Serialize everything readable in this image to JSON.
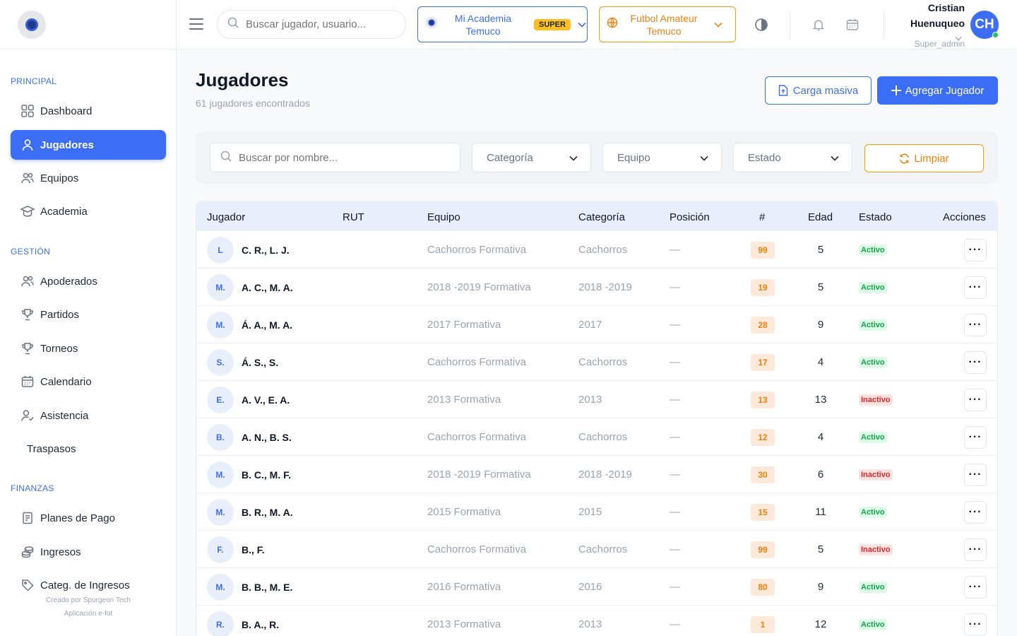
{
  "sidebar": {
    "sections": {
      "principal": "PRINCIPAL",
      "gestion": "GESTIÓN",
      "finanzas": "FINANZAS"
    },
    "items": {
      "dashboard": "Dashboard",
      "jugadores": "Jugadores",
      "equipos": "Equipos",
      "academia": "Academia",
      "apoderados": "Apoderados",
      "partidos": "Partidos",
      "torneos": "Torneos",
      "calendario": "Calendario",
      "asistencia": "Asistencia",
      "traspasos": "Traspasos",
      "planes": "Planes de Pago",
      "ingresos": "Ingresos",
      "categ": "Categ. de Ingresos"
    },
    "footer": {
      "created_by": "Creado por Spurgeon Tech",
      "app": "Aplicación e-fot"
    }
  },
  "header": {
    "search_placeholder": "Buscar jugador, usuario...",
    "academy": {
      "line1": "Mi Academia",
      "line2": "Temuco",
      "badge": "SUPER"
    },
    "league": {
      "line1": "Futbol Amateur",
      "line2": "Temuco"
    },
    "user": {
      "first": "Cristian",
      "last": "Huenuqueo",
      "role": "Super_admin",
      "initials": "CH"
    }
  },
  "page": {
    "title": "Jugadores",
    "subtitle": "61 jugadores encontrados",
    "btn_carga": "Carga masiva",
    "btn_agregar": "Agregar Jugador"
  },
  "filters": {
    "search_placeholder": "Buscar por nombre...",
    "categoria": "Categoría",
    "equipo": "Equipo",
    "estado": "Estado",
    "limpiar": "Limpiar"
  },
  "table": {
    "headers": {
      "jugador": "Jugador",
      "rut": "RUT",
      "equipo": "Equipo",
      "categoria": "Categoría",
      "posicion": "Posición",
      "numero": "#",
      "edad": "Edad",
      "estado": "Estado",
      "acciones": "Acciones"
    },
    "rows": [
      {
        "initial": "L",
        "name": "C. R., L. J.",
        "team": "Cachorros Formativa",
        "category": "Cachorros",
        "position": "—",
        "number": "99",
        "age": "5",
        "status": "Activo",
        "active": true,
        "actions": "···"
      },
      {
        "initial": "M.",
        "name": "A. C., M. A.",
        "team": "2018 -2019 Formativa",
        "category": "2018 -2019",
        "position": "—",
        "number": "19",
        "age": "5",
        "status": "Activo",
        "active": true,
        "actions": "···"
      },
      {
        "initial": "M.",
        "name": "Á. A., M. A.",
        "team": "2017 Formativa",
        "category": "2017",
        "position": "—",
        "number": "28",
        "age": "9",
        "status": "Activo",
        "active": true,
        "actions": "···"
      },
      {
        "initial": "S.",
        "name": "Á. S., S.",
        "team": "Cachorros Formativa",
        "category": "Cachorros",
        "position": "—",
        "number": "17",
        "age": "4",
        "status": "Activo",
        "active": true,
        "actions": "···"
      },
      {
        "initial": "E.",
        "name": "A. V., E. A.",
        "team": "2013 Formativa",
        "category": "2013",
        "position": "—",
        "number": "13",
        "age": "13",
        "status": "Inactivo",
        "active": false,
        "actions": "···"
      },
      {
        "initial": "B.",
        "name": "A. N., B. S.",
        "team": "Cachorros Formativa",
        "category": "Cachorros",
        "position": "—",
        "number": "12",
        "age": "4",
        "status": "Activo",
        "active": true,
        "actions": "···"
      },
      {
        "initial": "M.",
        "name": "B. C., M. F.",
        "team": "2018 -2019 Formativa",
        "category": "2018 -2019",
        "position": "—",
        "number": "30",
        "age": "6",
        "status": "Inactivo",
        "active": false,
        "actions": "···"
      },
      {
        "initial": "M.",
        "name": "B. R., M. A.",
        "team": "2015 Formativa",
        "category": "2015",
        "position": "—",
        "number": "15",
        "age": "11",
        "status": "Activo",
        "active": true,
        "actions": "···"
      },
      {
        "initial": "F.",
        "name": "B., F.",
        "team": "Cachorros Formativa",
        "category": "Cachorros",
        "position": "—",
        "number": "99",
        "age": "5",
        "status": "Inactivo",
        "active": false,
        "actions": "···"
      },
      {
        "initial": "M.",
        "name": "B. B., M. E.",
        "team": "2016 Formativa",
        "category": "2016",
        "position": "—",
        "number": "80",
        "age": "9",
        "status": "Activo",
        "active": true,
        "actions": "···"
      },
      {
        "initial": "R.",
        "name": "B. A., R.",
        "team": "2013 Formativa",
        "category": "2013",
        "position": "—",
        "number": "1",
        "age": "12",
        "status": "Activo",
        "active": true,
        "actions": "···"
      }
    ]
  },
  "colors": {
    "accent": "#3b6ef5",
    "orange": "#f07f0e",
    "active": "#16a34a",
    "inactive": "#dc2626"
  }
}
